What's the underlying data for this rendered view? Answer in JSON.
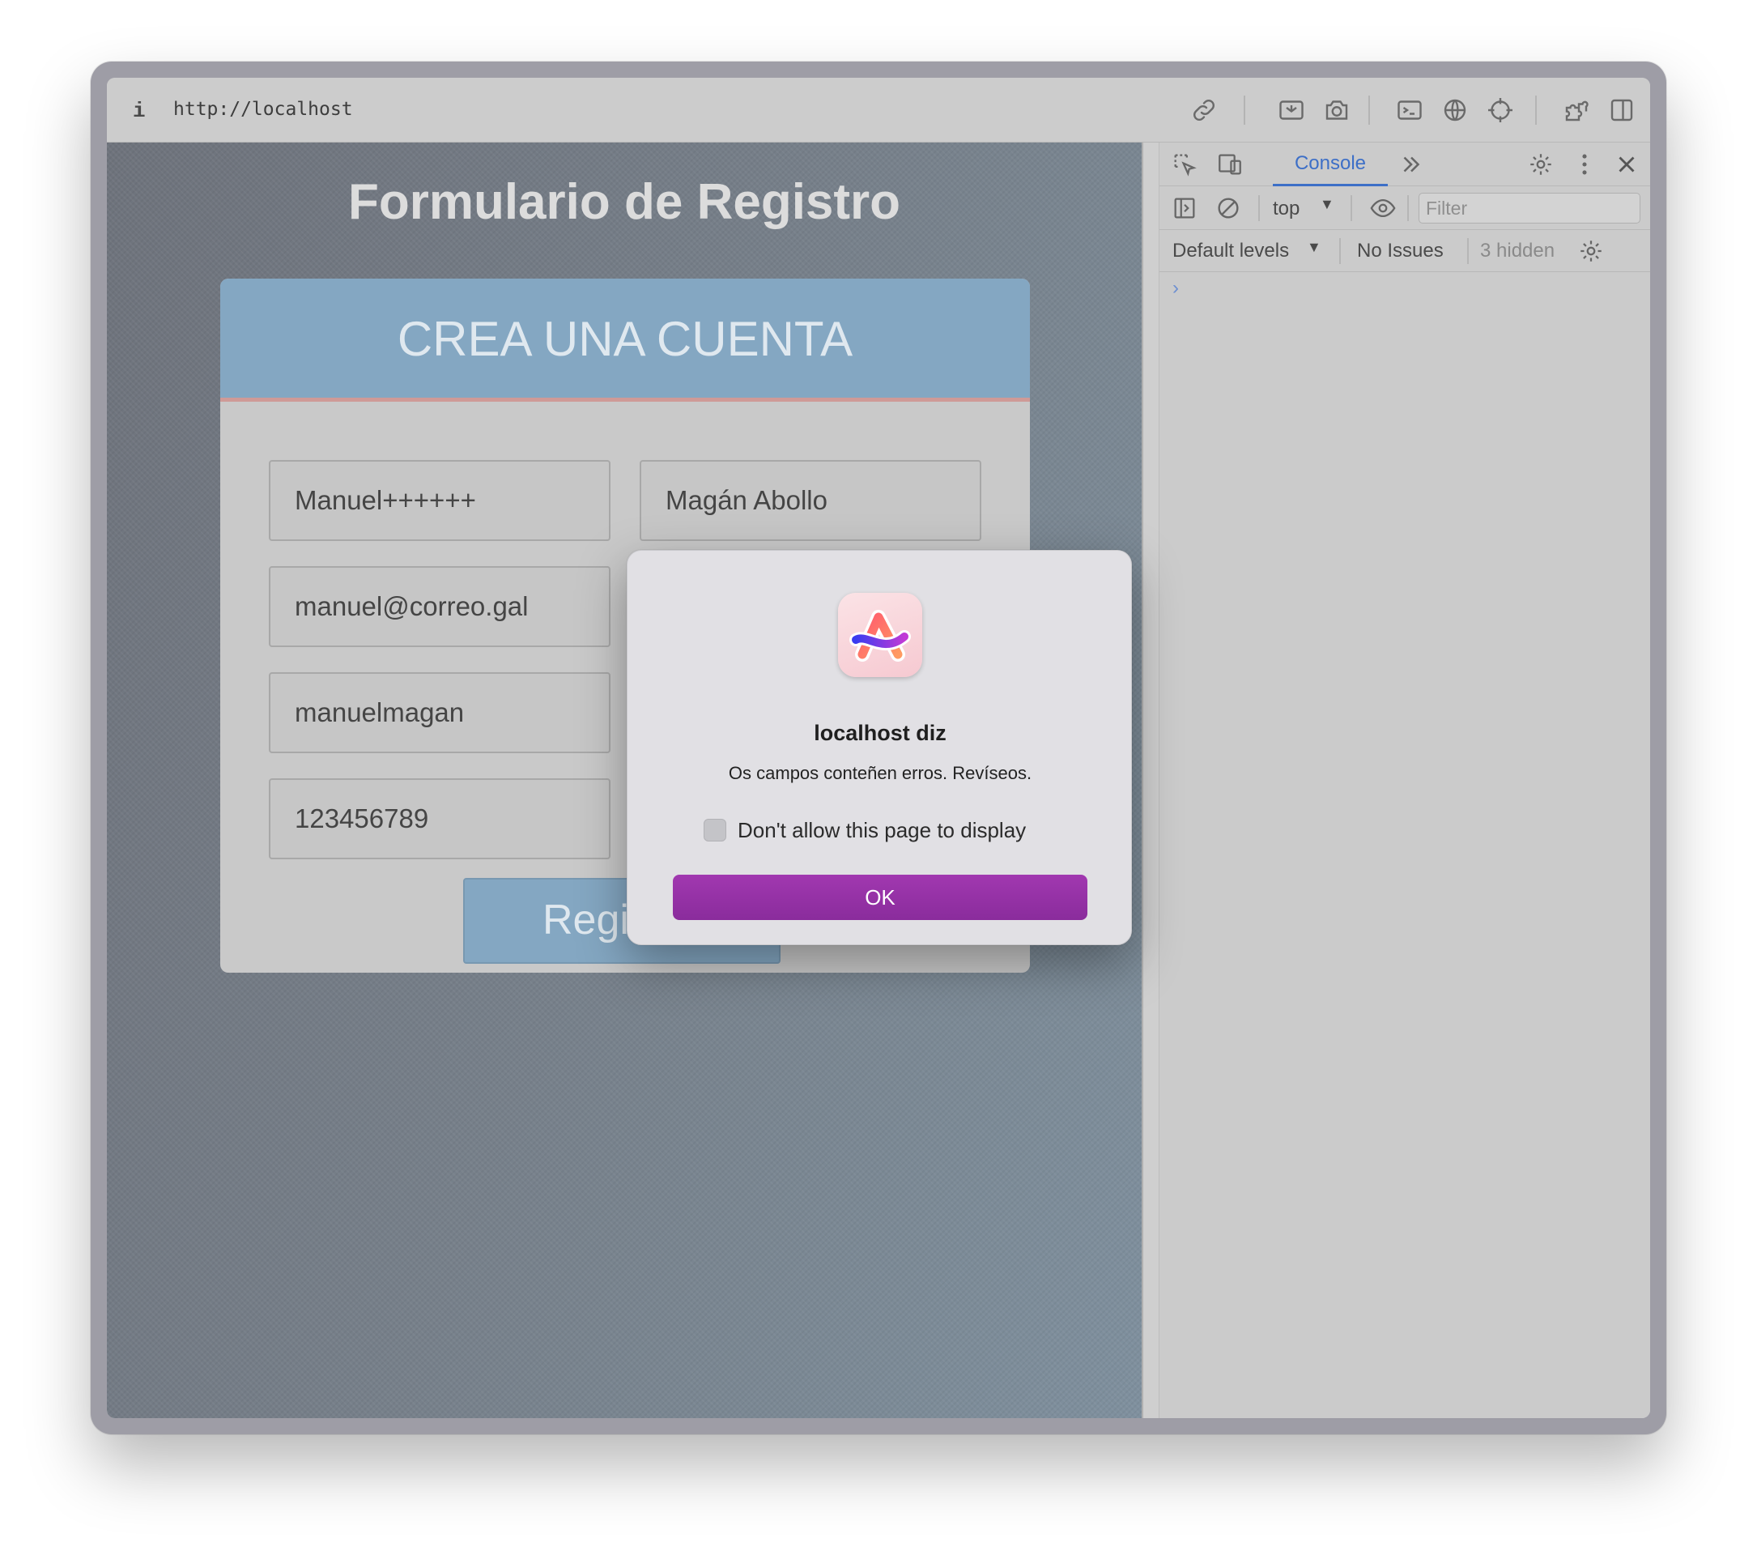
{
  "browser": {
    "url": "http://localhost",
    "info_icon": "i"
  },
  "page": {
    "title": "Formulario de Registro",
    "card_header": "CREA UNA CUENTA",
    "fields": {
      "first_name": "Manuel++++++",
      "last_name": "Magán Abollo",
      "email": "manuel@correo.gal",
      "username": "manuelmagan",
      "phone": "123456789"
    },
    "submit_label": "Regi"
  },
  "devtools": {
    "tab_console": "Console",
    "context": "top",
    "filter_placeholder": "Filter",
    "levels": "Default levels",
    "issues": "No Issues",
    "hidden": "3 hidden",
    "prompt": "›"
  },
  "dialog": {
    "title": "localhost diz",
    "message": "Os campos conteñen erros. Revíseos.",
    "checkbox_label": "Don't allow this page to display",
    "ok_label": "OK",
    "icon": "arc-browser-icon"
  }
}
